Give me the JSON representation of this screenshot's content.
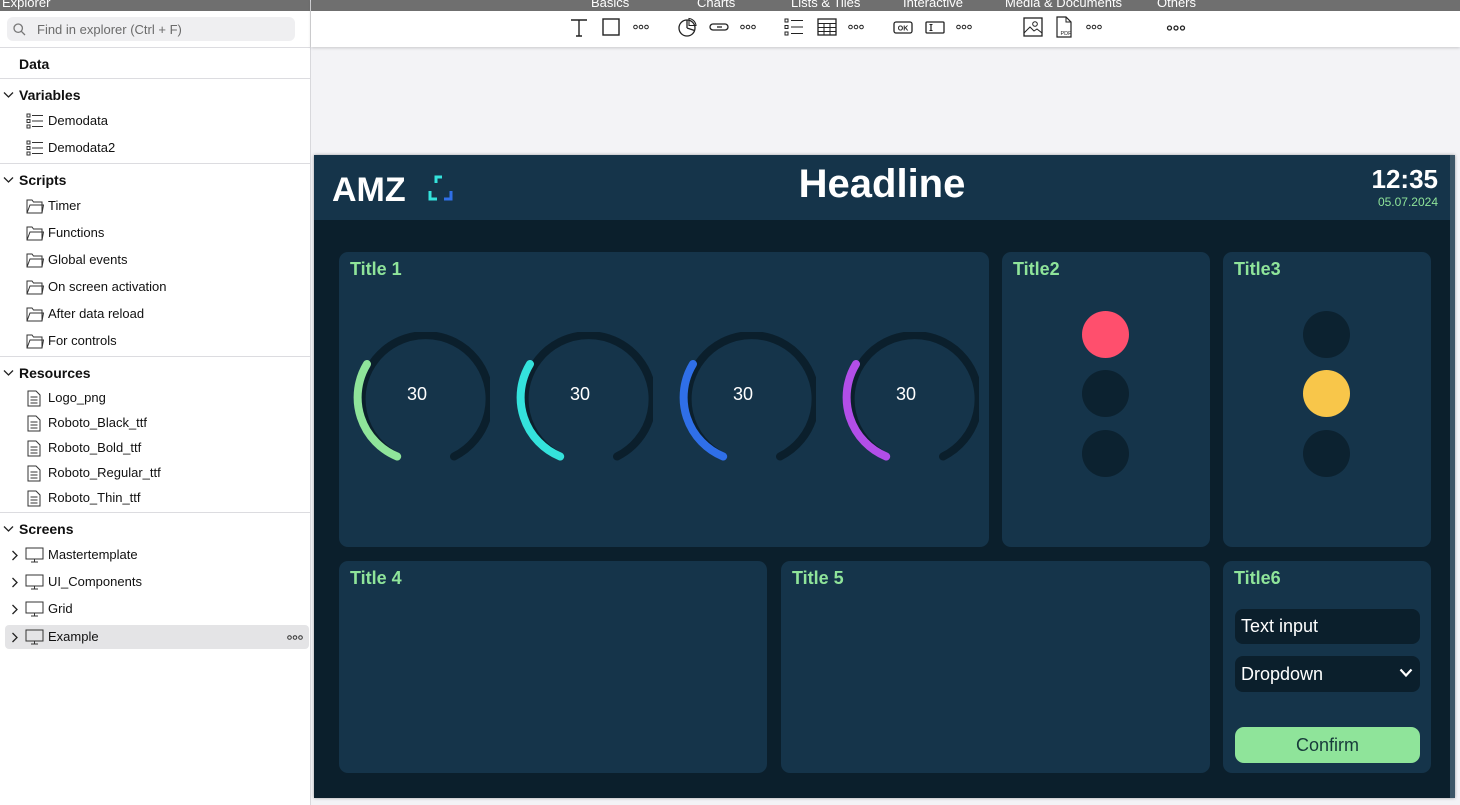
{
  "explorer": {
    "title": "Explorer",
    "search_placeholder": "Find in explorer (Ctrl + F)",
    "data_label": "Data",
    "variables": {
      "label": "Variables",
      "items": [
        "Demodata",
        "Demodata2"
      ]
    },
    "scripts": {
      "label": "Scripts",
      "items": [
        "Timer",
        "Functions",
        "Global events",
        "On screen activation",
        "After data reload",
        "For controls"
      ]
    },
    "resources": {
      "label": "Resources",
      "items": [
        "Logo_png",
        "Roboto_Black_ttf",
        "Roboto_Bold_ttf",
        "Roboto_Regular_ttf",
        "Roboto_Thin_ttf"
      ]
    },
    "screens": {
      "label": "Screens",
      "items": [
        "Mastertemplate",
        "UI_Components",
        "Grid",
        "Example"
      ],
      "selected": "Example"
    }
  },
  "toolbar": {
    "groups": [
      "Basics",
      "Charts",
      "Lists & Tiles",
      "Interactive",
      "Media & Documents",
      "Others"
    ],
    "icons": {
      "basics": [
        "text-icon",
        "rectangle-icon",
        "more-icon"
      ],
      "charts": [
        "pie-chart-icon",
        "slider-icon",
        "more-icon"
      ],
      "lists": [
        "list-icon",
        "table-icon",
        "more-icon"
      ],
      "interactive": [
        "ok-button-icon",
        "text-field-icon",
        "more-icon"
      ],
      "media": [
        "image-icon",
        "pdf-icon",
        "more-icon"
      ],
      "others": [
        "more-icon"
      ]
    },
    "ok_glyph": "OK",
    "pdf_glyph": "PDF"
  },
  "dashboard": {
    "logo_text": "AMZ",
    "headline": "Headline",
    "time": "12:35",
    "date": "05.07.2024",
    "cards": {
      "title1": "Title 1",
      "title2": "Title2",
      "title3": "Title3",
      "title4": "Title 4",
      "title5": "Title 5",
      "title6": "Title6"
    },
    "gauges": [
      {
        "value": "30",
        "color": "#8fe49a"
      },
      {
        "value": "30",
        "color": "#34e2dc"
      },
      {
        "value": "30",
        "color": "#2f6fe8"
      },
      {
        "value": "30",
        "color": "#b24ee8"
      }
    ],
    "traffic_light_2": {
      "active": "top",
      "active_color": "#ff4f6d"
    },
    "traffic_light_3": {
      "active": "middle",
      "active_color": "#f8c64a"
    },
    "form": {
      "text_input_value": "Text input",
      "dropdown_value": "Dropdown",
      "confirm_label": "Confirm"
    },
    "colors": {
      "accent": "#8fe49a",
      "background": "#0b1f2c",
      "panel": "#15344a"
    }
  }
}
